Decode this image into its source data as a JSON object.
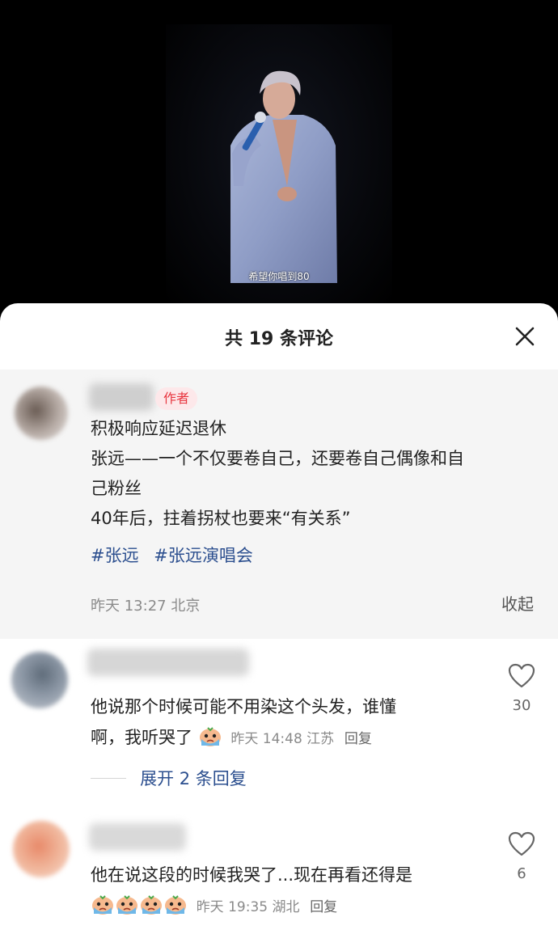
{
  "video": {
    "subtitle": "希望你唱到80"
  },
  "sheet": {
    "title": "共 19 条评论",
    "close_icon": "close-icon"
  },
  "pinned": {
    "badge": "作者",
    "lines": [
      "积极响应延迟退休",
      "张远——一个不仅要卷自己，还要卷自己偶像和自",
      "己粉丝",
      "40年后，拄着拐杖也要来“有关系”"
    ],
    "tags": [
      "#张远",
      "#张远演唱会"
    ],
    "meta": "昨天 13:27 北京",
    "collapse_label": "收起"
  },
  "comments": [
    {
      "line1": "他说那个时候可能不用染这个头发，谁懂",
      "line2": "啊，我听哭了",
      "meta": "昨天 14:48 江苏",
      "reply_label": "回复",
      "likes": "30",
      "emoji_count": 1,
      "expand_label": "展开 2 条回复"
    },
    {
      "line1": "他在说这段的时候我哭了...现在再看还得是",
      "meta": "昨天 19:35 湖北",
      "reply_label": "回复",
      "likes": "6",
      "emoji_count": 4
    }
  ],
  "colors": {
    "link": "#2c4f8f",
    "badge_text": "#e8353f",
    "badge_bg": "#fde8ea",
    "pinned_bg": "#f5f5f5"
  },
  "icons": [
    "close-icon",
    "heart-icon",
    "crying-emoji-icon"
  ]
}
